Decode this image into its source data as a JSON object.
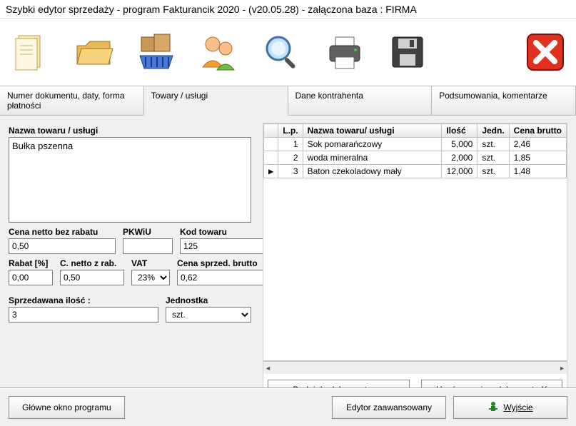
{
  "title": "Szybki edytor sprzedaży - program Fakturancik 2020 - (v20.05.28)  -  załączona baza : FIRMA",
  "toolbar": {
    "icons": [
      "document-icon",
      "folder-icon",
      "products-icon",
      "contractor-icon",
      "search-icon",
      "print-icon",
      "save-icon",
      "close-icon"
    ]
  },
  "tabs": {
    "t1": "Numer dokumentu, daty, forma płatności",
    "t2": "Towary  / usługi",
    "t3": "Dane kontrahenta",
    "t4": "Podsumowania, komentarze"
  },
  "form": {
    "name_label": "Nazwa towaru / usługi",
    "name_value": "Bułka pszenna",
    "netto_label": "Cena netto bez rabatu",
    "netto_value": "0,50",
    "pkwiu_label": "PKWiU",
    "pkwiu_value": "",
    "code_label": "Kod towaru",
    "code_value": "125",
    "rabat_label": "Rabat [%]",
    "rabat_value": "0,00",
    "netto_rab_label": "C. netto z rab.",
    "netto_rab_value": "0,50",
    "vat_label": "VAT",
    "vat_value": "23%",
    "brutto_label": "Cena sprzed. brutto",
    "brutto_value": "0,62",
    "qty_label": "Sprzedawana ilość :",
    "qty_value": "3",
    "unit_label": "Jednostka",
    "unit_value": "szt."
  },
  "grid": {
    "headers": {
      "lp": "L.p.",
      "name": "Nazwa towaru/ usługi",
      "qty": "Ilość",
      "unit": "Jedn.",
      "brutto": "Cena brutto"
    },
    "rows": [
      {
        "ptr": "",
        "lp": "1",
        "name": "Sok pomarańczowy",
        "qty": "5,000",
        "unit": "szt.",
        "brutto": "2,46"
      },
      {
        "ptr": "",
        "lp": "2",
        "name": "woda mineralna",
        "qty": "2,000",
        "unit": "szt.",
        "brutto": "1,85"
      },
      {
        "ptr": "▶",
        "lp": "3",
        "name": "Baton czekoladowy mały",
        "qty": "12,000",
        "unit": "szt.",
        "brutto": "1,48"
      }
    ]
  },
  "buttons": {
    "add": "Dodaj do dokumentu      >>",
    "del": "Usuń pozycję z dokumentu      X",
    "main": "Główne okno programu",
    "advanced": "Edytor zaawansowany",
    "exit": "Wyjście"
  }
}
